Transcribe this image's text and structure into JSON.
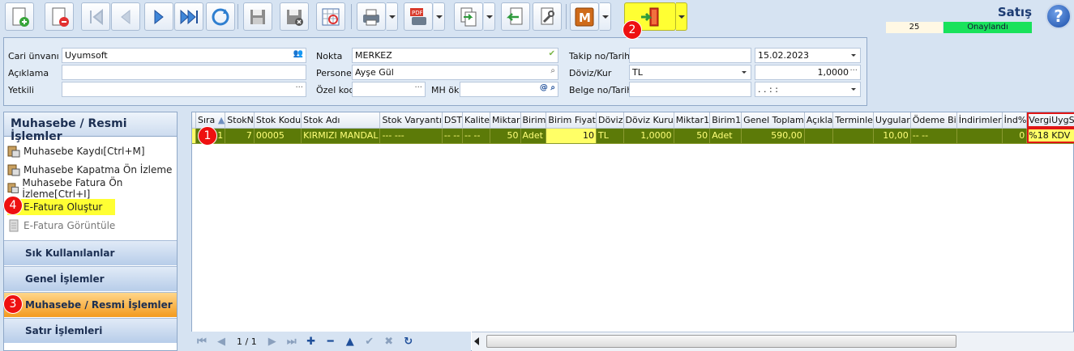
{
  "toolbar": {
    "buttons": [
      {
        "icon": "new-doc-icon"
      },
      {
        "icon": "delete-doc-icon"
      },
      {
        "icon": "first-record-icon"
      },
      {
        "icon": "prev-record-icon"
      },
      {
        "icon": "next-record-icon"
      },
      {
        "icon": "last-record-icon"
      },
      {
        "icon": "refresh-icon"
      },
      {
        "icon": "save-icon"
      },
      {
        "icon": "save-close-icon"
      },
      {
        "icon": "preview-icon"
      },
      {
        "icon": "print-icon"
      },
      {
        "icon": "pdf-icon"
      },
      {
        "icon": "copy-doc-icon"
      },
      {
        "icon": "back-icon"
      },
      {
        "icon": "tools-icon"
      },
      {
        "icon": "m-icon"
      },
      {
        "icon": "exit-icon"
      }
    ],
    "exit_color": "#ffff33"
  },
  "header": {
    "title": "Satış",
    "doc_number": "25",
    "status": "Onaylandı",
    "status_color": "#19e25b",
    "help": "?"
  },
  "markers": [
    "1",
    "2",
    "3",
    "4"
  ],
  "form": {
    "cari_unvani_label": "Cari ünvanı",
    "cari_unvani_value": "Uyumsoft",
    "aciklama_label": "Açıklama",
    "aciklama_value": "",
    "yetkili_label": "Yetkili",
    "yetkili_value": "",
    "nokta_label": "Nokta",
    "nokta_value": "MERKEZ",
    "personel_label": "Personel",
    "personel_value": "Ayşe Gül",
    "ozel_kod_label": "Özel kod",
    "ozel_kod_value": "",
    "mh_ok_label": "MH ök",
    "mh_ok_value": "",
    "takip_label": "Takip no/Tarih",
    "takip_value": "",
    "tarih_value": "15.02.2023",
    "doviz_label": "Döviz/Kur",
    "doviz_value": "TL",
    "kur_value": "1,0000",
    "belge_label": "Belge no/Tarih",
    "belge_value": "",
    "belge_tarih_value": ". .    : :",
    "ellipsis": "···"
  },
  "left_panel": {
    "title": "Muhasebe / Resmi İşlemler",
    "items": [
      {
        "label": "Muhasebe Kaydı[Ctrl+M]"
      },
      {
        "label": "Muhasebe Kapatma Ön İzleme"
      },
      {
        "label": "Muhasebe Fatura Ön İzleme[Ctrl+I]"
      },
      {
        "label": "E-Fatura Oluştur"
      },
      {
        "label": "E-Fatura Görüntüle"
      }
    ],
    "groups": [
      {
        "label": "Sık Kullanılanlar"
      },
      {
        "label": "Genel İşlemler"
      },
      {
        "label": "Muhasebe / Resmi İşlemler"
      },
      {
        "label": "Satır İşlemleri"
      }
    ]
  },
  "grid": {
    "columns": [
      "Sıra",
      "StokN",
      "Stok Kodu",
      "Stok Adı",
      "Stok Varyantı",
      "DST",
      "Kalite",
      "Miktar",
      "Birim",
      "Birim Fiyat",
      "Döviz",
      "Döviz Kuru",
      "Miktar1",
      "Birim1",
      "Genel Toplam",
      "Açıkla",
      "Terminle",
      "Uygular",
      "Ödeme Bi",
      "İndirimler",
      "İnd%",
      "VergiUygSeti"
    ],
    "rows": [
      [
        "1",
        "7",
        "00005",
        "KIRMIZI MANDAL",
        "--- ---",
        "-- --",
        "-- --",
        "50",
        "Adet",
        "10",
        "TL",
        "1,0000",
        "50",
        "Adet",
        "590,00",
        "",
        "",
        "10,00",
        "-- --",
        "",
        "0",
        "%18 KDV"
      ]
    ]
  },
  "nav": {
    "page": "1 / 1"
  }
}
